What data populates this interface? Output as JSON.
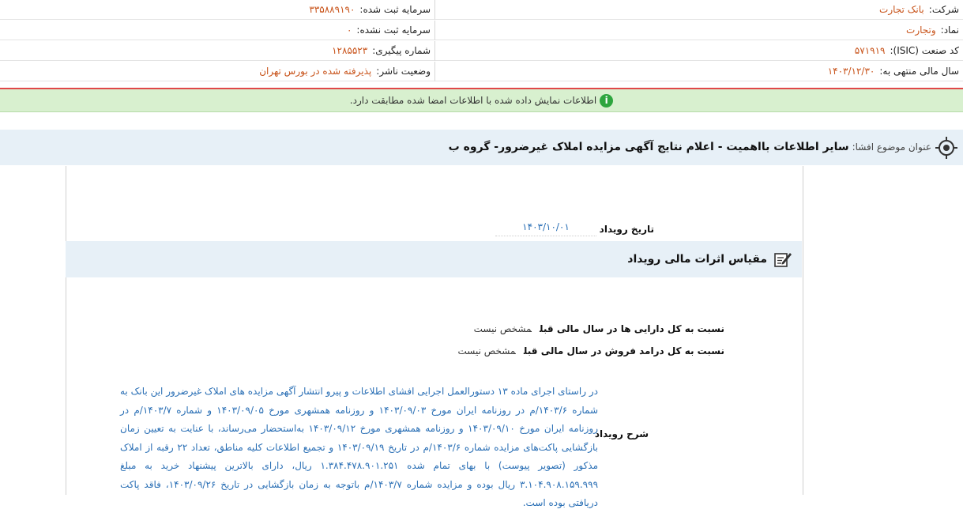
{
  "company_info": {
    "company_label": "شرکت:",
    "company_value": "بانک تجارت",
    "registered_capital_label": "سرمایه ثبت شده:",
    "registered_capital_value": "۳۳۵۸۸۹۱۹۰",
    "symbol_label": "نماد:",
    "symbol_value": "وتجارت",
    "unregistered_capital_label": "سرمایه ثبت نشده:",
    "unregistered_capital_value": "۰",
    "isic_label": "کد صنعت (ISIC):",
    "isic_value": "۵۷۱۹۱۹",
    "tracking_label": "شماره پیگیری:",
    "tracking_value": "۱۲۸۵۵۲۳",
    "fiscal_year_label": "سال مالی منتهی به:",
    "fiscal_year_value": "۱۴۰۳/۱۲/۳۰",
    "publisher_status_label": "وضعیت ناشر:",
    "publisher_status_value": "پذیرفته شده در بورس تهران"
  },
  "alert": {
    "icon": "info-icon",
    "text": "اطلاعات نمایش داده شده با اطلاعات امضا شده مطابقت دارد."
  },
  "subject": {
    "label": "عنوان موضوع افشا:",
    "value": "سایر اطلاعات بااهمیت - اعلام نتایج آگهی مزایده املاک غیرضرور- گروه ب"
  },
  "event_date": {
    "label": "تاریخ رویداد",
    "value": "۱۴۰۳/۱۰/۰۱"
  },
  "financial_effects": {
    "title": "مقیاس اثرات مالی رویداد",
    "rows": [
      {
        "label": "نسبت به کل دارایی ها در سال مالی قبل",
        "value": "مشخص نیست"
      },
      {
        "label": "نسبت به کل درامد فروش در سال مالی قبل",
        "value": "مشخص نیست"
      }
    ]
  },
  "description": {
    "label": "شرح رویداد",
    "text": "در راستای اجرای ماده ۱۳ دستورالعمل اجرایی افشای اطلاعات و پیرو انتشار آگهی مزایده های املاک غیرضرور این بانک به شماره ۱۴۰۳/۶/م در روزنامه ایران مورخ ۱۴۰۳/۰۹/۰۳ و روزنامه همشهری مورخ ۱۴۰۳/۰۹/۰۵ و شماره ۱۴۰۳/۷/م در روزنامه ایران مورخ ۱۴۰۳/۰۹/۱۰ و روزنامه همشهری مورخ ۱۴۰۳/۰۹/۱۲ به‌استحضار می‌رساند، با عنایت به تعیین زمان بازگشایی پاکت‌های مزایده شماره ۱۴۰۳/۶/م در تاریخ ۱۴۰۳/۰۹/۱۹ و تجمیع اطلاعات کلیه مناطق، تعداد ۲۲ رقبه از املاک مذکور (تصویر پیوست) با بهای تمام شده ۱.۳۸۴.۴۷۸.۹۰۱.۲۵۱ ریال، دارای بالاترین پیشنهاد خرید به مبلغ ۳.۱۰۴.۹۰۸.۱۵۹.۹۹۹ ریال بوده و مزایده شماره ۱۴۰۳/۷/م باتوجه به زمان بازگشایی در تاریخ ۱۴۰۳/۰۹/۲۶، فاقد پاکت دریافتی بوده است."
  },
  "colors": {
    "value_orange": "#c8531a",
    "link_blue": "#2a6fb5",
    "alert_green": "#d8f0cf",
    "section_blue": "#e7f0f7",
    "red_rule": "#e04848"
  }
}
